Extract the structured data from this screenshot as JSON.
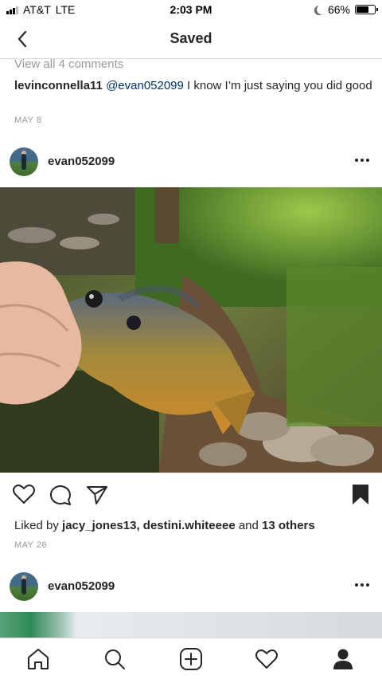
{
  "status_bar": {
    "carrier": "AT&T",
    "network": "LTE",
    "time": "2:03 PM",
    "battery_percent": "66%",
    "battery_level": 0.66
  },
  "nav": {
    "title": "Saved",
    "back_icon": "chevron-left-icon"
  },
  "previous_post": {
    "view_comments": "View all 4 comments",
    "comment": {
      "username": "levinconnella11",
      "mention": "@evan052099",
      "text": " I know I’m just saying you did good"
    },
    "date": "MAY 8"
  },
  "post": {
    "username": "evan052099",
    "more_icon": "more-horizontal-icon",
    "image_description_icon": "photo",
    "actions": {
      "like_icon": "heart-icon",
      "comment_icon": "comment-icon",
      "share_icon": "send-icon",
      "save_icon": "bookmark-filled-icon"
    },
    "likes": {
      "prefix": "Liked by ",
      "user1": "jacy_jones13",
      "separator": ", ",
      "user2": "destini.whiteeee",
      "middle": " and ",
      "others": "13 others"
    },
    "date": "MAY 26"
  },
  "next_post": {
    "username": "evan052099",
    "more_icon": "more-horizontal-icon"
  },
  "tabbar": {
    "items": [
      "home-icon",
      "search-icon",
      "add-icon",
      "heart-icon",
      "profile-icon"
    ]
  },
  "colors": {
    "text": "#262626",
    "muted": "#999999",
    "mention": "#003569",
    "border": "#dbdbdb"
  }
}
